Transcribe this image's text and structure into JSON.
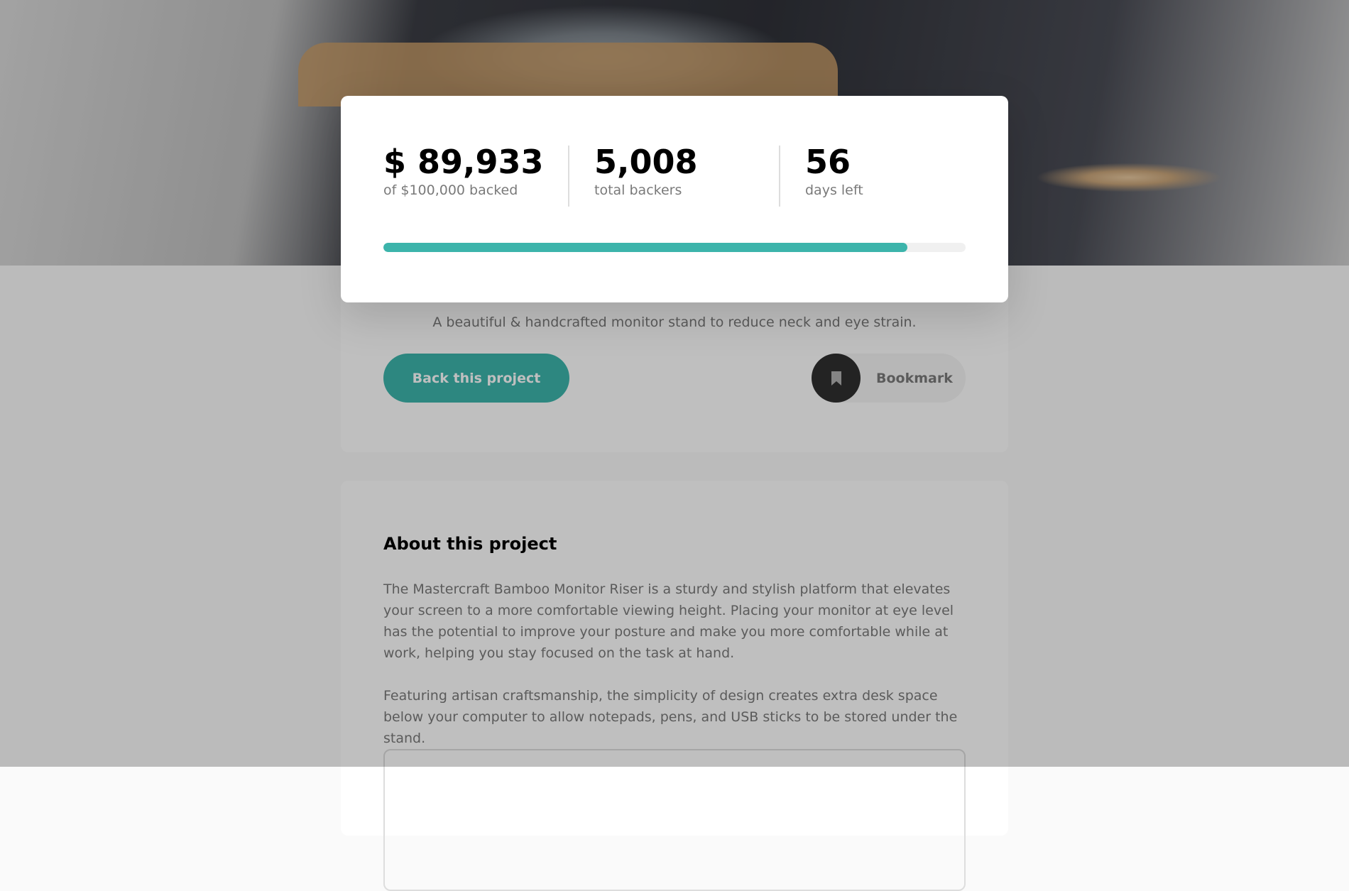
{
  "project": {
    "tagline": "A beautiful & handcrafted monitor stand to reduce neck and eye strain.",
    "back_button": "Back this project",
    "bookmark_button": "Bookmark"
  },
  "about": {
    "title": "About this project",
    "paragraphs": [
      "The Mastercraft Bamboo Monitor Riser is a sturdy and stylish platform that elevates your screen to a more comfortable viewing height. Placing your monitor at eye level has the potential to improve your posture and make you more comfortable while at work, helping you stay focused on the task at hand.",
      "Featuring artisan craftsmanship, the simplicity of design creates extra desk space below your computer to allow notepads, pens, and USB sticks to be stored under the stand."
    ]
  },
  "stats": {
    "amount": "$ 89,933",
    "amount_label": "of $100,000 backed",
    "backers": "5,008",
    "backers_label": "total backers",
    "days": "56",
    "days_label": "days left",
    "progress_percent": 90
  },
  "colors": {
    "accent": "#3cb4ab",
    "dark": "#2f2f2f"
  }
}
